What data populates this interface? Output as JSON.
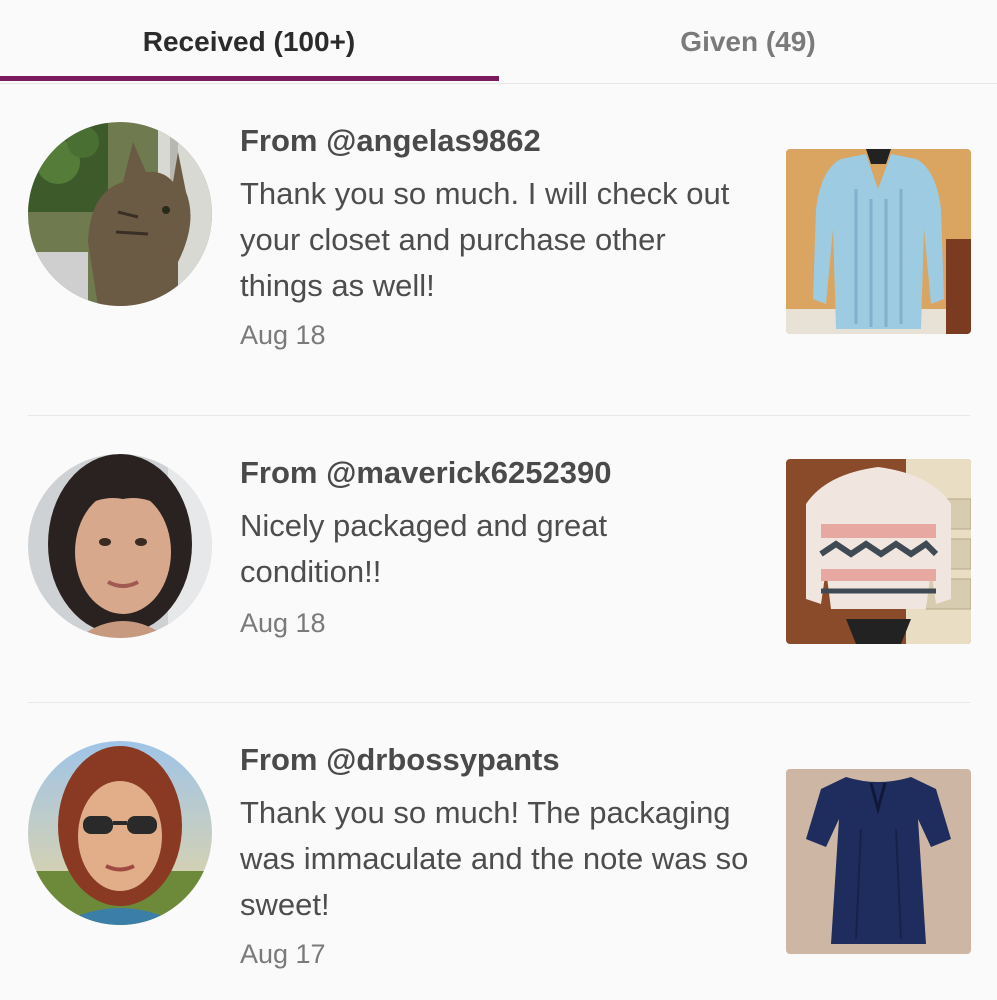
{
  "tabs": {
    "received_label": "Received (100+)",
    "given_label": "Given (49)"
  },
  "colors": {
    "accent": "#7b1a5c",
    "text_primary": "#4a4a4a",
    "text_secondary": "#7a7a7a"
  },
  "reviews": [
    {
      "from": "From @angelas9862",
      "message": "Thank you so much. I will check out your closet and purchase other things as well!",
      "date": "Aug 18",
      "avatar_icon": "cat-photo",
      "item_icon": "light-blue-sweater-photo"
    },
    {
      "from": "From @maverick6252390",
      "message": "Nicely packaged and great condition!!",
      "date": "Aug 18",
      "avatar_icon": "woman-dark-hair-photo",
      "item_icon": "patterned-sweater-photo"
    },
    {
      "from": "From @drbossypants",
      "message": "Thank you so much! The packaging was immaculate and the note was so sweet!",
      "date": "Aug 17",
      "avatar_icon": "woman-sunglasses-photo",
      "item_icon": "navy-dress-photo"
    }
  ]
}
